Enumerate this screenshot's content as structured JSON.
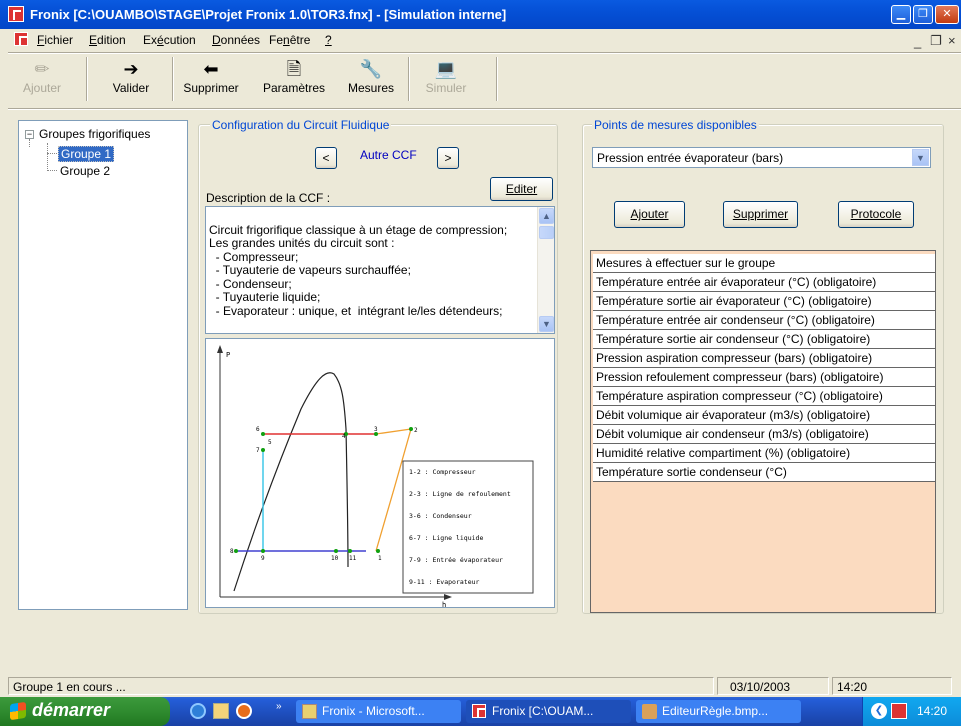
{
  "window": {
    "title": "Fronix [C:\\OUAMBO\\STAGE\\Projet Fronix 1.0\\TOR3.fnx] - [Simulation interne]"
  },
  "menu": {
    "items": [
      {
        "label": "Fichier",
        "u": "F",
        "rest": "ichier"
      },
      {
        "label": "Edition",
        "u": "E",
        "rest": "dition"
      },
      {
        "label": "Exécution",
        "pre": "Ex",
        "u": "é",
        "rest": "cution"
      },
      {
        "label": "Données",
        "u": "D",
        "rest": "onnées"
      },
      {
        "label": "Fenêtre",
        "pre": "Fe",
        "u": "n",
        "rest": "être"
      },
      {
        "label": "?",
        "u": "?",
        "rest": ""
      }
    ]
  },
  "toolbar": {
    "ajouter": "Ajouter",
    "valider": "Valider",
    "supprimer": "Supprimer",
    "parametres": "Paramètres",
    "mesures": "Mesures",
    "simuler": "Simuler"
  },
  "tree": {
    "root": "Groupes frigorifiques",
    "expander": "−",
    "items": [
      "Groupe 1",
      "Groupe 2"
    ]
  },
  "ccf": {
    "group_title": "Configuration du Circuit Fluidique",
    "prev": "<",
    "next": ">",
    "current": "Autre CCF",
    "desc_label": "Description de la CCF :",
    "edit_button": "Editer",
    "description": [
      "Circuit frigorifique classique à un étage de compression;",
      "Les grandes unités du circuit sont :",
      "  - Compresseur;",
      "  - Tuyauterie de vapeurs surchauffée;",
      "  - Condenseur;",
      "  - Tuyauterie liquide;",
      "  - Evaporateur : unique, et  intégrant le/les détendeurs;"
    ]
  },
  "diagram": {
    "y_axis": "P",
    "x_axis": "h",
    "points": [
      "1",
      "2",
      "3",
      "4",
      "5",
      "6",
      "7",
      "9",
      "10",
      "11",
      "8"
    ],
    "legend": [
      "1-2 : Compresseur",
      "2-3 : Ligne de refoulement",
      "3-6 : Condenseur",
      "6-7 : Ligne liquide",
      "7-9 : Entrée évaporateur",
      "9-11 : Evaporateur"
    ],
    "colors": {
      "condenser": "#e03030",
      "liquid": "#40c8e8",
      "evaporator": "#4040d0",
      "compressor": "#f0a030",
      "curve": "#222222",
      "points": "#10a010"
    }
  },
  "measures": {
    "group_title": "Points de mesures disponibles",
    "selected": "Pression entrée évaporateur (bars)",
    "add": "Ajouter",
    "remove": "Supprimer",
    "protocol": "Protocole",
    "list_header": "Mesures à effectuer sur le groupe",
    "rows": [
      "Température entrée air évaporateur (°C) (obligatoire)",
      "Température sortie air évaporateur (°C) (obligatoire)",
      "Température entrée air condenseur (°C) (obligatoire)",
      "Température sortie air condenseur (°C) (obligatoire)",
      "Pression aspiration compresseur (bars) (obligatoire)",
      "Pression refoulement compresseur (bars) (obligatoire)",
      "Température aspiration compresseur (°C) (obligatoire)",
      "Débit volumique air évaporateur (m3/s) (obligatoire)",
      "Débit volumique air condenseur (m3/s) (obligatoire)",
      "Humidité relative compartiment (%) (obligatoire)",
      "Température sortie condenseur (°C)"
    ]
  },
  "status": {
    "text": "Groupe 1 en cours ...",
    "date": "03/10/2003",
    "time": "14:20"
  },
  "taskbar": {
    "start": "démarrer",
    "tasks": [
      "Fronix - Microsoft...",
      "Fronix [C:\\OUAM...",
      "EditeurRègle.bmp..."
    ],
    "clock": "14:20"
  }
}
